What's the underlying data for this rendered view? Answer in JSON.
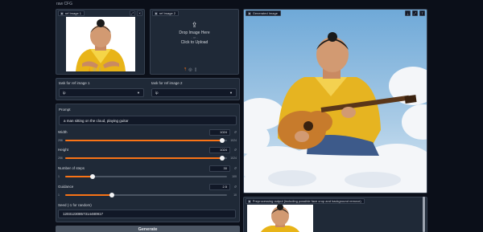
{
  "header": {
    "subtitle": "raw CFG"
  },
  "ref_image_1": {
    "label": "ref Image 1",
    "icons": [
      "download-icon",
      "share-icon",
      "clear-icon"
    ],
    "tool_icons": [
      "fullscreen-icon",
      "close-icon"
    ]
  },
  "ref_image_2": {
    "label": "ref Image 2",
    "drop_text": "Drop Image Here",
    "or_text": "- or -",
    "click_text": "Click to Upload",
    "icons": [
      "upload-icon",
      "webcam-icon",
      "clipboard-icon"
    ]
  },
  "tasks": {
    "task1": {
      "label": "task for ref image 1",
      "value": "ip"
    },
    "task2": {
      "label": "task for ref image 2",
      "value": "ip"
    }
  },
  "prompt": {
    "label": "Prompt",
    "value": "a man sitting on the cloud, playing guitar"
  },
  "sliders": {
    "width": {
      "label": "Width",
      "value": "1024",
      "min": "256",
      "max": "1024",
      "fraction": 0.97
    },
    "height": {
      "label": "Height",
      "value": "1024",
      "min": "256",
      "max": "1024",
      "fraction": 0.97
    },
    "steps": {
      "label": "Number of steps",
      "value": "30",
      "min": "1",
      "max": "100",
      "fraction": 0.17
    },
    "guidance": {
      "label": "Guidance",
      "value": "2.5",
      "min": "1",
      "max": "10",
      "fraction": 0.29
    }
  },
  "seed": {
    "label": "Seed (-1 for random)",
    "value": "12031230857314480917"
  },
  "generate_label": "Generate",
  "output": {
    "label": "Generated Image",
    "tools": [
      "download-icon",
      "fullscreen-icon",
      "share-icon"
    ]
  },
  "preprocess": {
    "label": "Preprocessing output (including possible face crop and background remove)"
  },
  "colors": {
    "accent": "#f97316",
    "background": "#0b0f19",
    "panel": "#1f2937"
  }
}
